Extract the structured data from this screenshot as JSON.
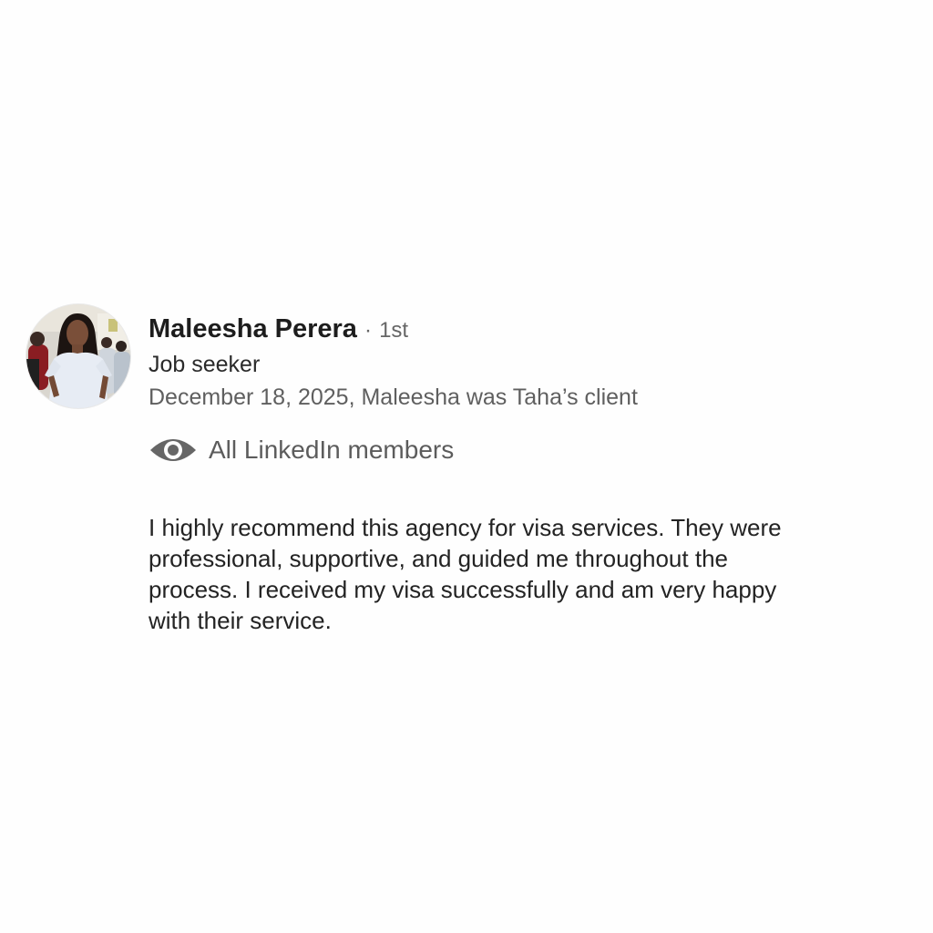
{
  "recommendation": {
    "author": {
      "name": "Maleesha Perera",
      "degree_separator": "·",
      "degree": "1st",
      "headline": "Job seeker",
      "avatar_icon": "profile-photo"
    },
    "meta_line": "December 18, 2025, Maleesha was Taha’s client",
    "visibility": {
      "icon": "eye-icon",
      "label": "All LinkedIn members"
    },
    "text": "I highly recommend this agency for visa services. They were\nprofessional, supportive, and guided me throughout the\nprocess. I received my visa successfully and am very happy\nwith their service."
  },
  "colors": {
    "background": "#fefefe",
    "name_text": "#1d1d1d",
    "secondary_text": "#5f5f5f",
    "icon_gray": "#666666"
  }
}
